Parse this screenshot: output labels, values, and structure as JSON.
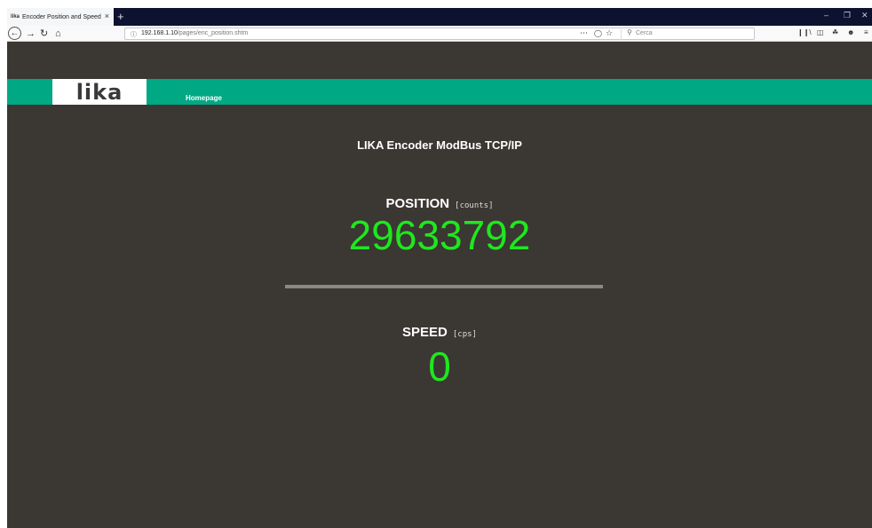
{
  "browser": {
    "tab_favicon": "lika",
    "tab_title": "Encoder Position and Speed",
    "tab_close": "×",
    "new_tab": "+",
    "url_host": "192.168.1.10",
    "url_path": "/pages/enc_position.shtm",
    "search_placeholder": "Cerca",
    "icons": {
      "back": "back-arrow-icon",
      "forward": "forward-arrow-icon",
      "reload": "reload-icon",
      "home": "home-icon",
      "info": "info-icon",
      "page_actions": "more-dots-icon",
      "pocket": "pocket-icon",
      "bookmark": "star-icon",
      "search": "search-icon",
      "library": "library-icon",
      "sidebar": "sidebar-icon",
      "extension": "extension-icon",
      "account": "account-icon",
      "menu": "hamburger-menu-icon",
      "minimize": "minimize-icon",
      "restore": "restore-icon",
      "close": "close-icon"
    }
  },
  "header": {
    "logo_text": "lika",
    "nav_home": "Homepage",
    "accent_color": "#00a884"
  },
  "main": {
    "title": "LIKA Encoder ModBus TCP/IP",
    "position": {
      "label": "POSITION",
      "unit": "[counts]",
      "value": "29633792"
    },
    "speed": {
      "label": "SPEED",
      "unit": "[cps]",
      "value": "0"
    },
    "value_color": "#1ee81e",
    "background_color": "#3b3733"
  }
}
